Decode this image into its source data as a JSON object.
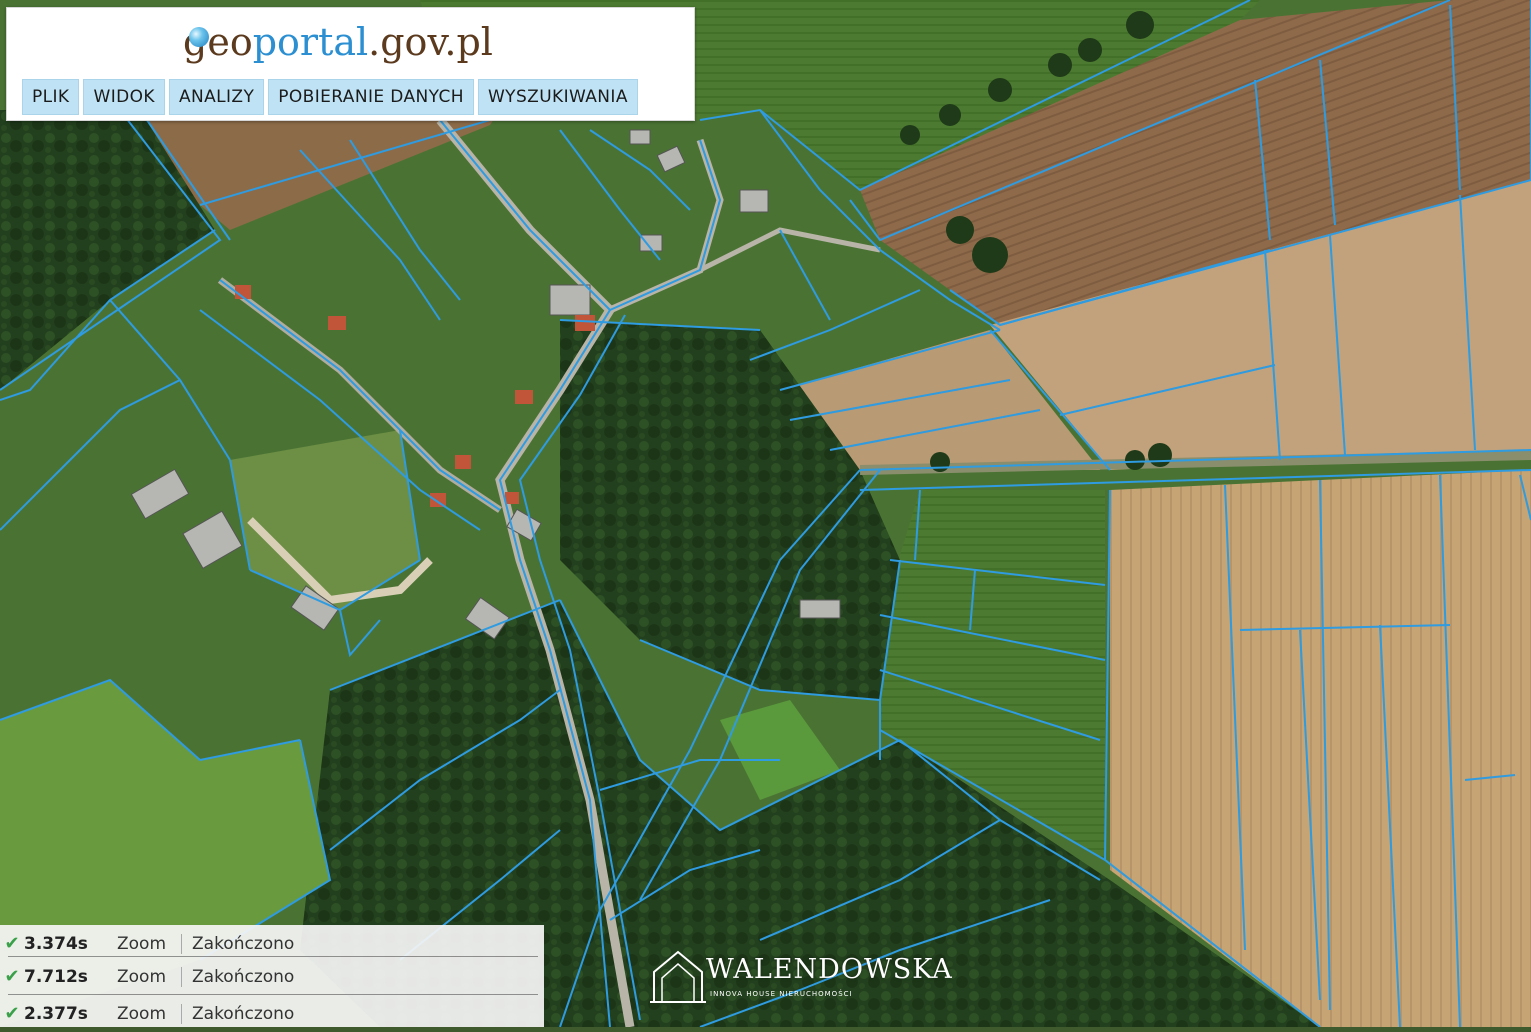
{
  "logo": {
    "part_geo": "geo",
    "part_portal": "portal",
    "part_domain": ".gov.pl",
    "colors": {
      "geo": "#5b3a1e",
      "portal": "#2b8fd1",
      "domain": "#5b3a1e"
    }
  },
  "menu": {
    "items": [
      {
        "label": "PLIK"
      },
      {
        "label": "WIDOK"
      },
      {
        "label": "ANALIZY"
      },
      {
        "label": "POBIERANIE DANYCH"
      },
      {
        "label": "WYSZUKIWANIA"
      }
    ]
  },
  "status": {
    "rows": [
      {
        "time": "3.374s",
        "action": "Zoom",
        "state": "Zakończono"
      },
      {
        "time": "7.712s",
        "action": "Zoom",
        "state": "Zakończono"
      },
      {
        "time": "2.377s",
        "action": "Zoom",
        "state": "Zakończono"
      }
    ]
  },
  "watermark": {
    "name": "WALENDOWSKA",
    "subtitle": "INNOVA HOUSE NIERUCHOMOŚCI"
  },
  "colors": {
    "parcel_line": "#2f9be0",
    "forest": "#233d1c",
    "meadow": "#4f7a34",
    "field_brown": "#8c6a4a",
    "field_tan": "#c9a878",
    "road": "#b8b4a8"
  }
}
